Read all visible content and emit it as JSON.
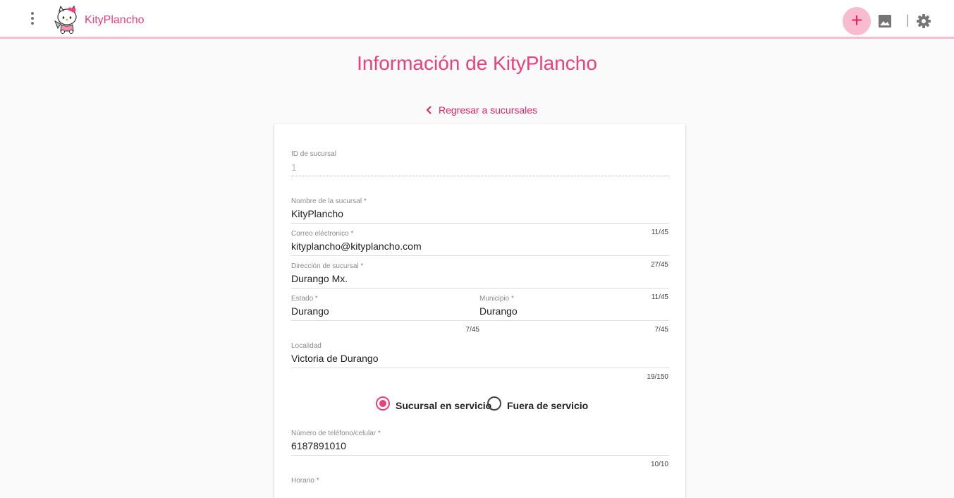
{
  "app": {
    "title": "KityPlancho",
    "accent": "#ec407a",
    "accent_light": "#f8bbd0"
  },
  "toolbar": {
    "menu_icon": "more-vert-icon",
    "add_symbol": "+",
    "add_icon": "add-icon",
    "image_icon": "image-icon",
    "separator": "|",
    "settings_icon": "gear-icon"
  },
  "page": {
    "title": "Información de KityPlancho",
    "back_label": "Regresar a sucursales"
  },
  "form": {
    "id_field": {
      "label": "ID de sucursal",
      "value": "1"
    },
    "nombre": {
      "label": "Nombre de la sucursal *",
      "value": "KityPlancho",
      "counter": "11/45"
    },
    "correo": {
      "label": "Correo eléctronico *",
      "value": "kityplancho@kityplancho.com",
      "counter": "27/45"
    },
    "direccion": {
      "label": "Dirección de sucursal *",
      "value": "Durango Mx.",
      "counter": "11/45"
    },
    "estado": {
      "label": "Estado *",
      "value": "Durango",
      "counter": "7/45"
    },
    "municipio": {
      "label": "Municipio *",
      "value": "Durango",
      "counter": "7/45"
    },
    "localidad": {
      "label": "Localidad",
      "value": "Victoria de Durango",
      "counter": "19/150"
    },
    "status": {
      "options": [
        "Sucursal en servicio",
        "Fuera de servicio"
      ],
      "selected": "Sucursal en servicio"
    },
    "telefono": {
      "label": "Número de teléfono/celular *",
      "value": "6187891010",
      "counter": "10/10"
    },
    "horario": {
      "label": "Horario *"
    }
  }
}
